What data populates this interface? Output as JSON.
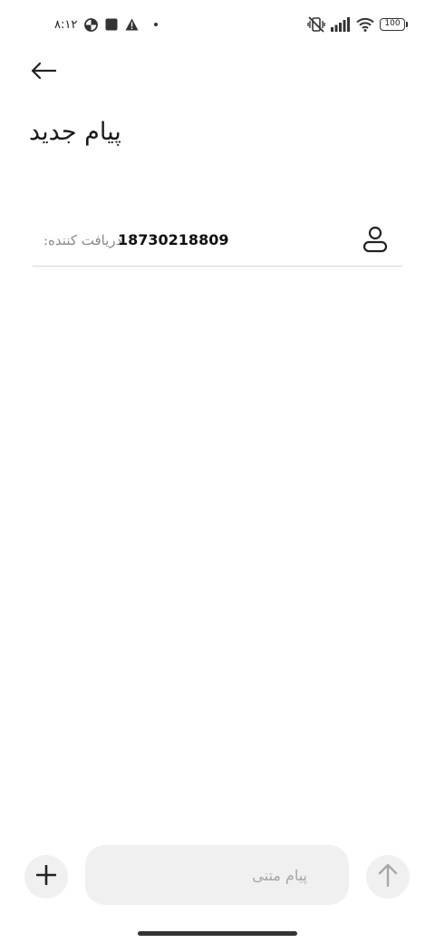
{
  "status_bar": {
    "time": "۸:۱۲",
    "battery_level": "100",
    "icons": [
      "data-saver-icon",
      "square-app-icon",
      "warning-icon",
      "dot-icon",
      "vibrate-off-icon",
      "signal-icon",
      "wifi-icon",
      "battery-icon"
    ]
  },
  "header": {
    "back_icon": "arrow-left-icon",
    "title": "پیام جدید"
  },
  "recipient": {
    "label": "دریافت کننده:",
    "number": "18730218809",
    "contact_icon": "person-icon"
  },
  "compose": {
    "add_icon": "plus-icon",
    "placeholder": "پیام متنی",
    "send_icon": "arrow-up-icon"
  }
}
